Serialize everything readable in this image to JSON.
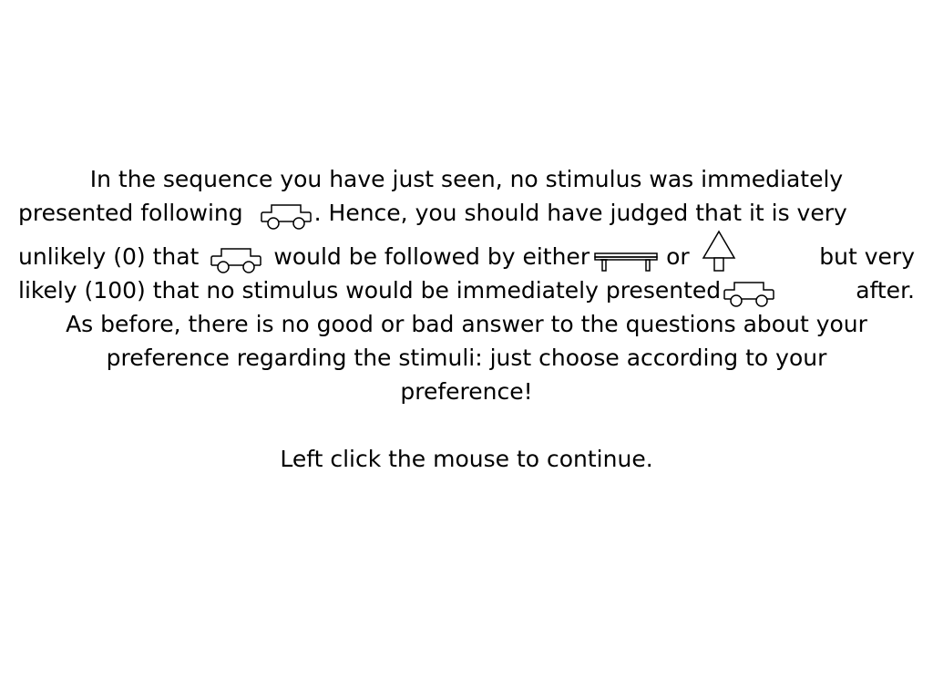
{
  "instructions": {
    "l1": "In the sequence you have just seen, no stimulus was immediately",
    "l2a": "presented following",
    "l2b": ". Hence, you should have judged that it is very",
    "l3a": "unlikely (0) that",
    "l3b": "would be followed by either",
    "l3c": "or",
    "l3d": "but very",
    "l4a": "likely (100) that no stimulus would be immediately presented",
    "l4b": "after.",
    "l5": "As before, there is no good or bad answer to the questions about your",
    "l6": "preference regarding the stimuli: just choose according to your",
    "l7": "preference!",
    "continue": "Left click the mouse to continue."
  },
  "icons": {
    "car": "car-icon",
    "bench": "bench-icon",
    "tree": "tree-icon"
  },
  "colors": {
    "background": "#ffffff",
    "text": "#000000"
  }
}
